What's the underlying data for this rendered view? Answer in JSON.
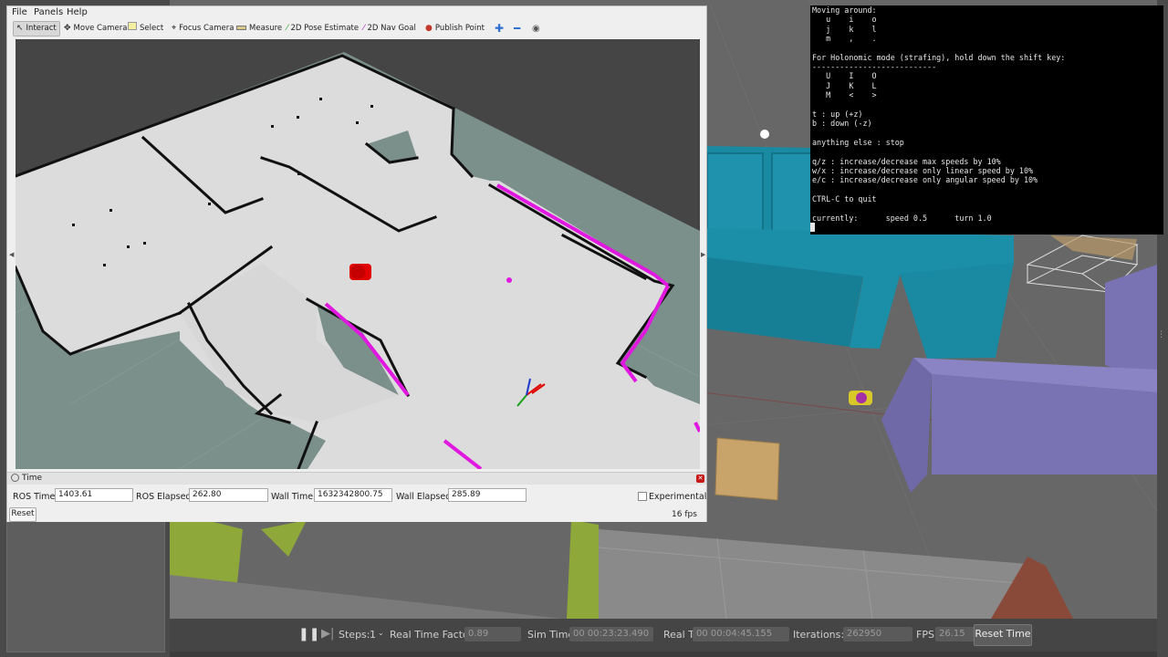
{
  "rviz": {
    "menu": [
      "File",
      "Panels",
      "Help"
    ],
    "toolbar": {
      "interact": "Interact",
      "move_camera": "Move Camera",
      "select": "Select",
      "focus_camera": "Focus Camera",
      "measure": "Measure",
      "pose_estimate": "2D Pose Estimate",
      "nav_goal": "2D Nav Goal",
      "publish_point": "Publish Point"
    },
    "time_panel": {
      "title": "Time",
      "ros_time_label": "ROS Time:",
      "ros_time": "1403.61",
      "ros_elapsed_label": "ROS Elapsed:",
      "ros_elapsed": "262.80",
      "wall_time_label": "Wall Time:",
      "wall_time": "1632342800.75",
      "wall_elapsed_label": "Wall Elapsed:",
      "wall_elapsed": "285.89",
      "experimental_label": "Experimental",
      "reset_label": "Reset",
      "fps": "16 fps"
    }
  },
  "terminal": {
    "lines": [
      "Moving around:",
      "   u    i    o",
      "   j    k    l",
      "   m    ,    .",
      "",
      "For Holonomic mode (strafing), hold down the shift key:",
      "---------------------------",
      "   U    I    O",
      "   J    K    L",
      "   M    <    >",
      "",
      "t : up (+z)",
      "b : down (-z)",
      "",
      "anything else : stop",
      "",
      "q/z : increase/decrease max speeds by 10%",
      "w/x : increase/decrease only linear speed by 10%",
      "e/c : increase/decrease only angular speed by 10%",
      "",
      "CTRL-C to quit",
      "",
      "currently:\tspeed 0.5\tturn 1.0"
    ]
  },
  "gazebo_toolbar": {
    "steps_label": "Steps:",
    "steps_value": "1",
    "rtf_label": "Real Time Factor:",
    "rtf_value": "0.89",
    "sim_time_label": "Sim Time:",
    "sim_time_value": "00 00:23:23.490",
    "real_time_label": "Real Time:",
    "real_time_value": "00 00:04:45.155",
    "iterations_label": "Iterations:",
    "iterations_value": "262950",
    "fps_label": "FPS:",
    "fps_value": "26.15",
    "reset_time_label": "Reset Time"
  }
}
